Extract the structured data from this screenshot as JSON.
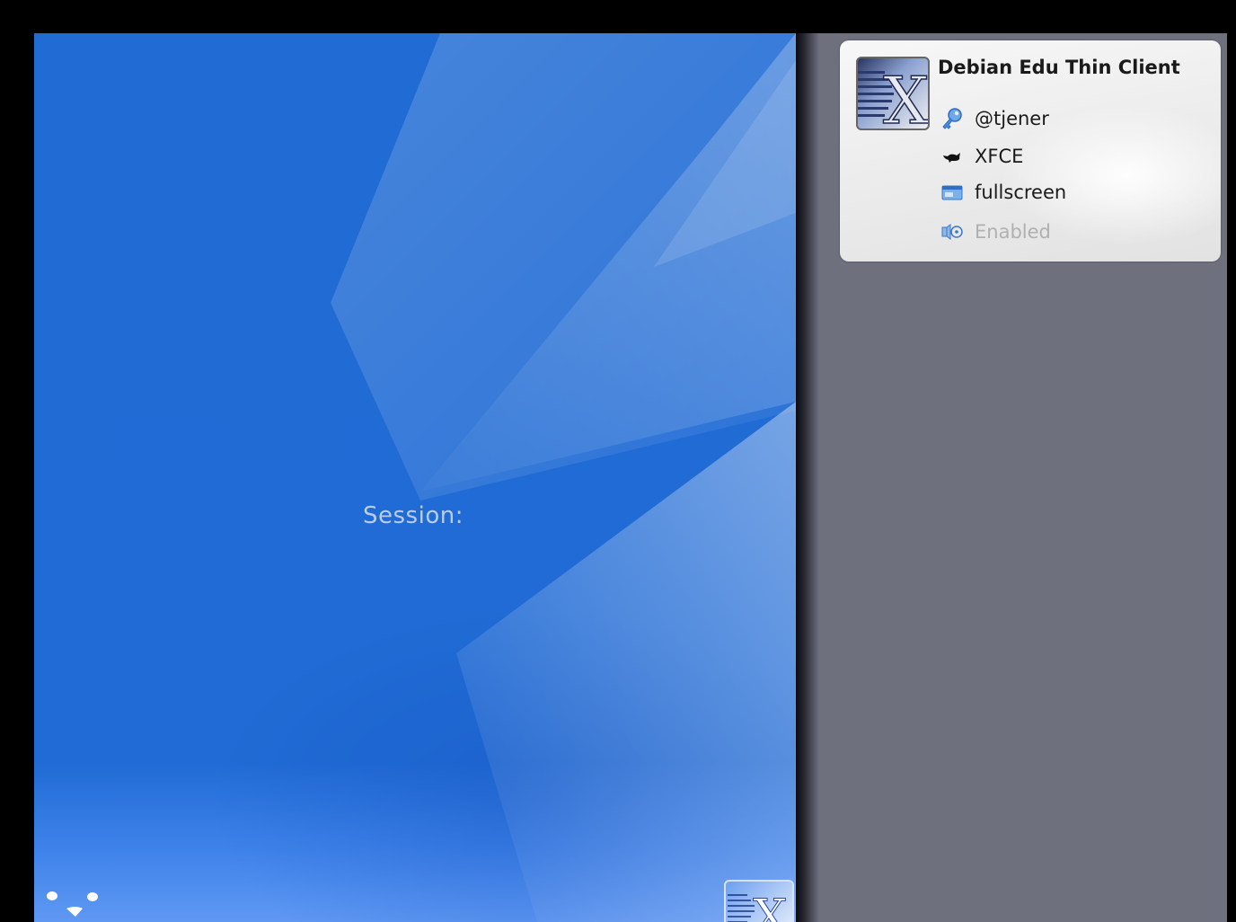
{
  "login_panel": {
    "session_label": "Session:",
    "paw_logo_icon": "debian-edu-paw-logo",
    "x_logo_icon": "x2go-logo"
  },
  "info_card": {
    "logo_icon": "x2go-logo",
    "title": "Debian Edu Thin Client",
    "rows": [
      {
        "icon": "key-icon",
        "text": "@tjener"
      },
      {
        "icon": "mouse-icon",
        "text": "XFCE"
      },
      {
        "icon": "window-icon",
        "text": "fullscreen"
      },
      {
        "icon": "speaker-icon",
        "text": "Enabled"
      }
    ]
  },
  "colors": {
    "background_blue": "#206bd4",
    "right_area_grey": "#6f707e",
    "card_background": "#eeeeee",
    "session_label": "#b9cdea",
    "disabled_text": "#b0b0b0"
  }
}
